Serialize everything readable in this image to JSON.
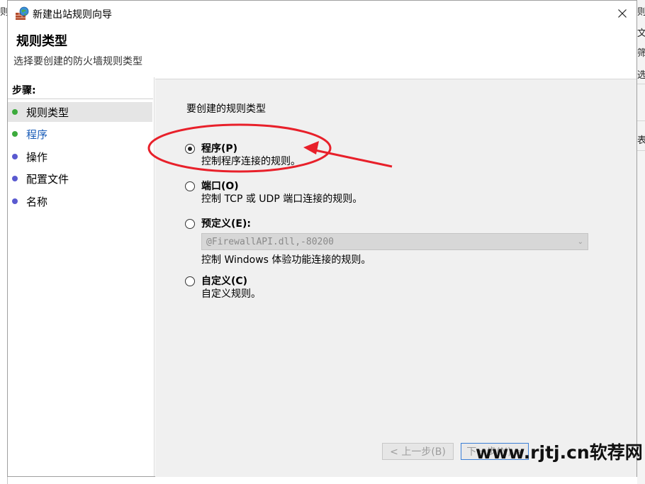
{
  "background_window": {
    "left_fragment": "则",
    "right_fragments": [
      "则",
      "文",
      "筛",
      "选",
      "表"
    ]
  },
  "window": {
    "title": "新建出站规则向导",
    "icon": "firewall-icon",
    "close_icon": "close-icon"
  },
  "page": {
    "title": "规则类型",
    "subtitle": "选择要创建的防火墙规则类型"
  },
  "steps": {
    "header": "步骤:",
    "items": [
      {
        "label": "规则类型",
        "dot_color": "#3cab3c",
        "active": true,
        "link": false
      },
      {
        "label": "程序",
        "dot_color": "#3cab3c",
        "active": false,
        "link": true
      },
      {
        "label": "操作",
        "dot_color": "#5a5ad0",
        "active": false,
        "link": false
      },
      {
        "label": "配置文件",
        "dot_color": "#5a5ad0",
        "active": false,
        "link": false
      },
      {
        "label": "名称",
        "dot_color": "#5a5ad0",
        "active": false,
        "link": false
      }
    ]
  },
  "content": {
    "prompt": "要创建的规则类型",
    "options": [
      {
        "label": "程序(P)",
        "description": "控制程序连接的规则。",
        "checked": true
      },
      {
        "label": "端口(O)",
        "description": "控制 TCP 或 UDP 端口连接的规则。",
        "checked": false
      },
      {
        "label": "预定义(E):",
        "description": "控制 Windows 体验功能连接的规则。",
        "checked": false
      },
      {
        "label": "自定义(C)",
        "description": "自定义规则。",
        "checked": false
      }
    ],
    "predefined_select_value": "@FirewallAPI.dll,-80200"
  },
  "buttons": {
    "back": "< 上一步(B)",
    "next": "下一步(N) >"
  },
  "annotation_color": "#e8202a",
  "watermark": "www.rjtj.cn软荐网"
}
